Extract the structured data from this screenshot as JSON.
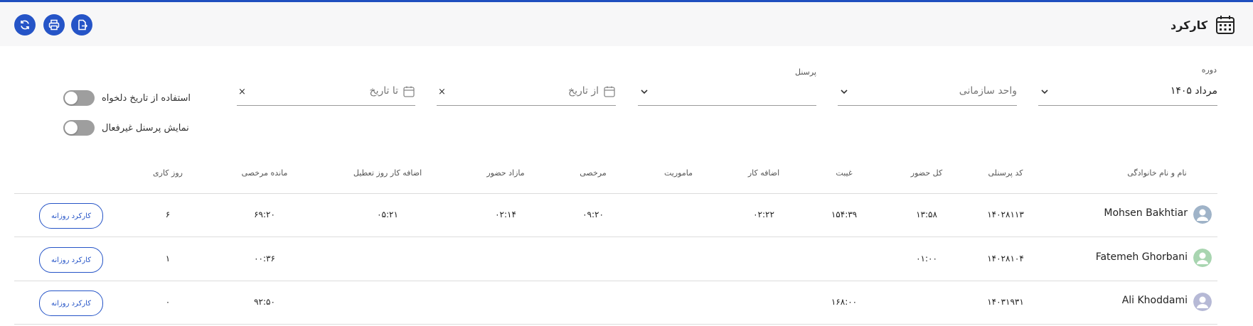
{
  "header": {
    "title": "کارکرد",
    "buttons": [
      "export-icon",
      "print-icon",
      "refresh-icon"
    ],
    "accent": "#2554c7"
  },
  "filters": {
    "period": {
      "label": "دوره",
      "value": "۱۴۰۵ مرداد"
    },
    "org_unit": {
      "placeholder": "واحد سازمانی"
    },
    "personnel": {
      "label": "پرسنل",
      "value": ""
    },
    "from_date": {
      "placeholder": "از تاریخ"
    },
    "to_date": {
      "placeholder": "تا تاریخ"
    },
    "clear": "×"
  },
  "toggles": {
    "custom_date": {
      "label": "استفاده از تاریخ دلخواه",
      "on": false
    },
    "inactive_personnel": {
      "label": "نمایش پرسنل غیرفعال",
      "on": false
    }
  },
  "table": {
    "headers": {
      "name": "نام و نام خانوادگی",
      "code": "کد پرسنلی",
      "total_presence": "کل حضور",
      "absence": "غیبت",
      "overtime": "اضافه کار",
      "mission": "ماموریت",
      "leave": "مرخصی",
      "extra_presence": "مازاد حضور",
      "holiday_overtime": "اضافه کار روز تعطیل",
      "remaining_leave": "مانده مرخصی",
      "workdays": "روز کاری"
    },
    "action_label": "کارکرد روزانه",
    "rows": [
      {
        "name": "Mohsen Bakhtiar",
        "code": "۱۴۰۲۸۱۱۳",
        "total_presence": "۱۳:۵۸",
        "absence": "۱۵۴:۳۹",
        "overtime": "۰۲:۲۲",
        "mission": "",
        "leave": "۰۹:۲۰",
        "extra_presence": "۰۲:۱۴",
        "holiday_overtime": "۰۵:۲۱",
        "remaining_leave": "۶۹:۲۰",
        "workdays": "۶",
        "avatar_color": "#9fb3c8"
      },
      {
        "name": "Fatemeh Ghorbani",
        "code": "۱۴۰۲۸۱۰۴",
        "total_presence": "۰۱:۰۰",
        "absence": "",
        "overtime": "",
        "mission": "",
        "leave": "",
        "extra_presence": "",
        "holiday_overtime": "",
        "remaining_leave": "۰۰:۳۶",
        "workdays": "۱",
        "avatar_color": "#a8d5b0"
      },
      {
        "name": "Ali Khoddami",
        "code": "۱۴۰۳۱۹۳۱",
        "total_presence": "",
        "absence": "۱۶۸:۰۰",
        "overtime": "",
        "mission": "",
        "leave": "",
        "extra_presence": "",
        "holiday_overtime": "",
        "remaining_leave": "۹۲:۵۰",
        "workdays": "۰",
        "avatar_color": "#b6b9d6"
      }
    ]
  }
}
